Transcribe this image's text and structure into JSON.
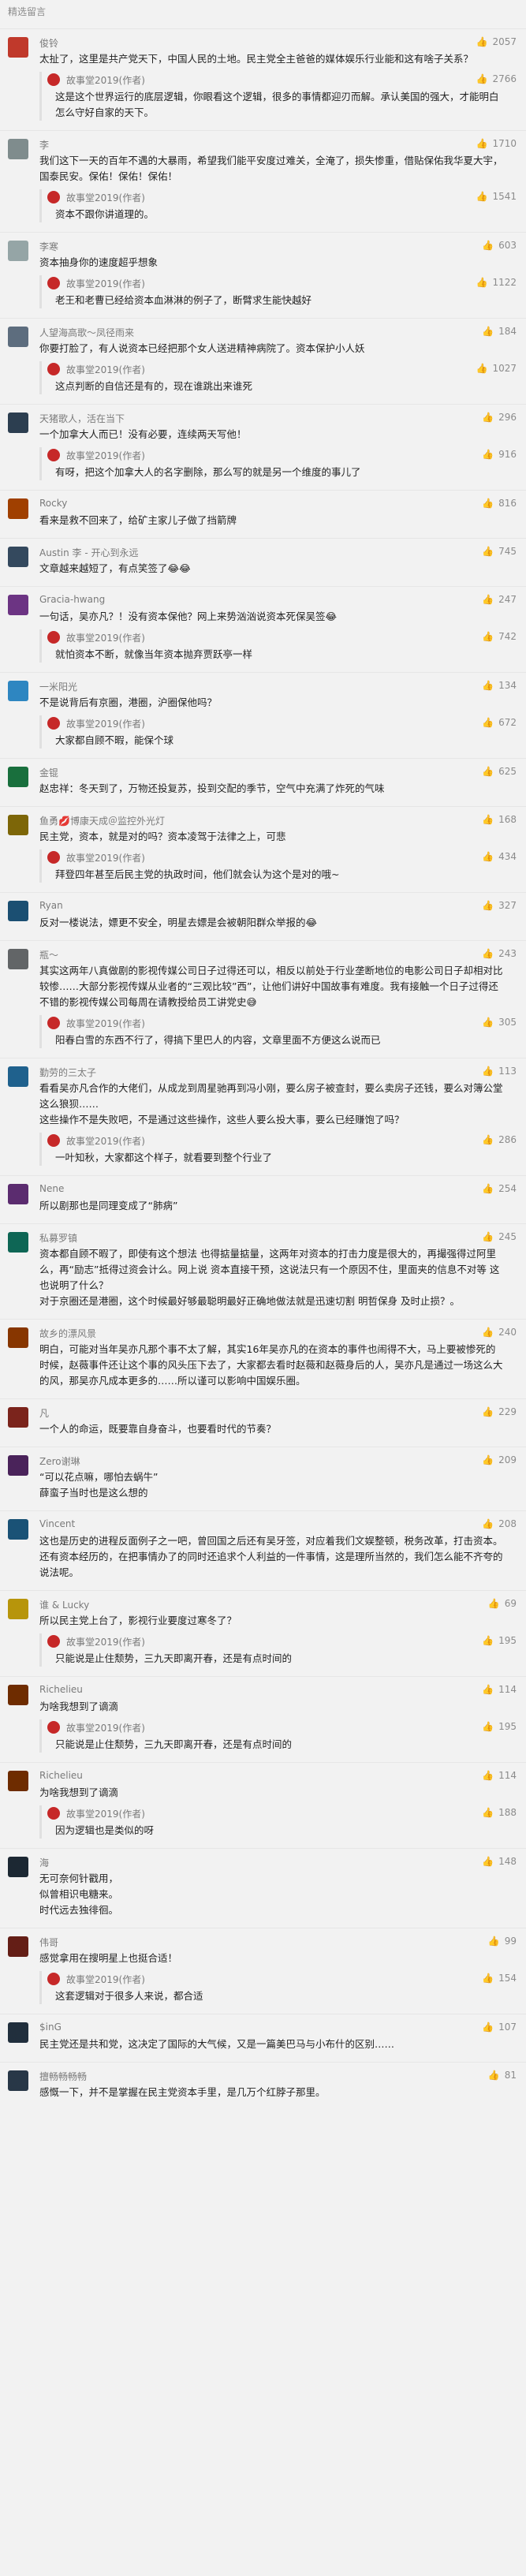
{
  "section_title": "精选留言",
  "author": "故事堂2019(作者)",
  "comments": [
    {
      "user": "俊铃",
      "likes": "2057",
      "color": "#c0392b",
      "text": "太扯了，这里是共产党天下，中国人民的土地。民主党全主爸爸的媒体娱乐行业能和这有啥子关系？",
      "reply_likes": "2766",
      "reply": "这是这个世界运行的底层逻辑，你眼看这个逻辑，很多的事情都迎刃而解。承认美国的强大，才能明白怎么守好自家的天下。"
    },
    {
      "user": "李",
      "likes": "1710",
      "color": "#7f8c8d",
      "text": "我们这下一天的百年不遇的大暴雨，希望我们能平安度过难关，全淹了，损失惨重，借贴保佑我华夏大宇，国泰民安。保佑！保佑！保佑！",
      "reply_likes": "1541",
      "reply": "资本不跟你讲道理的。"
    },
    {
      "user": "李寒",
      "likes": "603",
      "color": "#95a5a6",
      "text": "资本抽身你的速度超乎想象",
      "reply_likes": "1122",
      "reply": "老王和老曹已经给资本血淋淋的例子了，断臂求生能快越好"
    },
    {
      "user": "人望海高歌～凤径雨来",
      "likes": "184",
      "color": "#5d6d7e",
      "text": "你要打脸了，有人说资本已经把那个女人送进精神病院了。资本保护小人妖",
      "reply_likes": "1027",
      "reply": "这点判断的自信还是有的，现在谁跳出来谁死"
    },
    {
      "user": "天猪歌人，活在当下",
      "likes": "296",
      "color": "#2c3e50",
      "text": "一个加拿大人而已！没有必要，连续两天写他！",
      "reply_likes": "916",
      "reply": "有呀，把这个加拿大人的名字删除，那么写的就是另一个维度的事儿了"
    },
    {
      "user": "Rocky",
      "likes": "816",
      "color": "#a04000",
      "text": "看来是救不回来了，给矿主家儿子做了挡箭牌",
      "reply_likes": "",
      "reply": ""
    },
    {
      "user": "Austin 李 - 开心到永远",
      "likes": "745",
      "color": "#34495e",
      "text": "文章越来越短了，有点笑签了😂😂",
      "reply_likes": "",
      "reply": ""
    },
    {
      "user": "Gracia-hwang",
      "likes": "247",
      "color": "#6c3483",
      "text": "一句话，吴亦凡？！没有资本保他？网上来势汹汹说资本死保吴签😂",
      "reply_likes": "742",
      "reply": "就怕资本不断，就像当年资本抛弃贾跃亭一样"
    },
    {
      "user": "一米阳光",
      "likes": "134",
      "color": "#2e86c1",
      "text": "不是说背后有京圈，港圈，沪圈保他吗？",
      "reply_likes": "672",
      "reply": "大家都自顾不暇，能保个球"
    },
    {
      "user": "金锟",
      "likes": "625",
      "color": "#196f3d",
      "text": "赵忠祥：冬天到了，万物还投复苏，投到交配的季节，空气中充满了炸死的气味",
      "reply_likes": "",
      "reply": ""
    },
    {
      "user": "鱼勇💋博康天成＠监控外光灯",
      "likes": "168",
      "color": "#7d6608",
      "text": "民主党，资本，就是对的吗？资本凌驾于法律之上，可悲",
      "reply_likes": "434",
      "reply": "拜登四年甚至后民主党的执政时间，他们就会认为这个是对的哦~"
    },
    {
      "user": "Ryan",
      "likes": "327",
      "color": "#1b4f72",
      "text": "反对一楼说法，嫖更不安全，明星去嫖是会被朝阳群众举报的😂",
      "reply_likes": "",
      "reply": ""
    },
    {
      "user": "瓶～",
      "likes": "243",
      "color": "#626567",
      "text": "其实这两年八真做剧的影视传媒公司日子过得还可以，相反以前处于行业垄断地位的电影公司日子却相对比较惨……大部分影视传媒从业者的“三观比较”西”，让他们讲好中国故事有难度。我有接触一个日子过得还不错的影视传媒公司每周在请教授给员工讲党史😅",
      "reply_likes": "305",
      "reply": "阳春白雪的东西不行了，得搞下里巴人的内容，文章里面不方便这么说而已"
    },
    {
      "user": "勤劳的三太子",
      "likes": "113",
      "color": "#1f618d",
      "text": "看看吴亦凡合作的大佬们，从成龙到周星驰再到冯小刚，要么房子被查封，要么卖房子还钱，要么对簿公堂这么狼狈……\n这些操作不是失败吧，不是通过这些操作，这些人要么投大事，要么已经赚饱了吗？",
      "reply_likes": "286",
      "reply": "一叶知秋，大家都这个样子，就看要到整个行业了"
    },
    {
      "user": "Nene",
      "likes": "254",
      "color": "#5b2c6f",
      "text": "所以剧那也是同理变成了“肺病”",
      "reply_likes": "",
      "reply": ""
    },
    {
      "user": "私募罗镇",
      "likes": "245",
      "color": "#0e6655",
      "text": "资本都自顾不暇了，即使有这个想法 也得掂量掂量，这两年对资本的打击力度是很大的，再撮强得过阿里么，再“励志”抵得过资会计么。网上说 资本直接干预，这说法只有一个原因不住，里面夹的信息不对等 这也说明了什么？\n对于京圈还是港圈，这个时候最好够最聪明最好正确地做法就是迅速切割 明哲保身 及时止损？。",
      "reply_likes": "",
      "reply": ""
    },
    {
      "user": "故乡的漂风景",
      "likes": "240",
      "color": "#873600",
      "text": "明白，可能对当年吴亦凡那个事不太了解，其实16年吴亦凡的在资本的事件也闹得不大，马上要被惨死的时候，赵薇事件还让这个事的风头压下去了，大家都去看时赵薇和赵薇身后的人，吴亦凡是通过一场这么大的风，那吴亦凡成本更多的……所以谨可以影响中国娱乐圈。",
      "reply_likes": "",
      "reply": ""
    },
    {
      "user": "凡",
      "likes": "229",
      "color": "#7b241c",
      "text": "一个人的命运，既要靠自身奋斗，也要看时代的节奏？",
      "reply_likes": "",
      "reply": ""
    },
    {
      "user": "Zero谢琳",
      "likes": "209",
      "color": "#4a235a",
      "text": "“可以花点嘛，哪怕去蜗牛”\n薛蛮子当时也是这么想的",
      "reply_likes": "",
      "reply": ""
    },
    {
      "user": "Vincent",
      "likes": "208",
      "color": "#1a5276",
      "text": "这也是历史的进程反面例子之一吧，曾回国之后还有吴牙签，对应着我们文娱整顿，税务改革，打击资本。还有资本经历的，在把事情办了的同时还追求个人利益的一件事情，这是理所当然的，我们怎么能不齐夸的说法呢。",
      "reply_likes": "",
      "reply": ""
    },
    {
      "user": "谁 & Lucky",
      "likes": "69",
      "color": "#b7950b",
      "text": "所以民主党上台了，影视行业要度过寒冬了？",
      "reply_likes": "195",
      "reply": "只能说是止住颓势，三九天即离开春，还是有点时间的"
    },
    {
      "user": "Richelieu",
      "likes": "114",
      "color": "#6e2c00",
      "text": "为啥我想到了谪滴",
      "reply_likes": "195",
      "reply": "只能说是止住颓势，三九天即离开春，还是有点时间的"
    },
    {
      "user": "Richelieu",
      "likes": "114",
      "color": "#6e2c00",
      "text": "为啥我想到了谪滴",
      "reply_likes": "188",
      "reply": "因为逻辑也是类似的呀"
    },
    {
      "user": "海",
      "likes": "148",
      "color": "#1c2833",
      "text": "无可奈何针戳用，\n似曾相识电糖来。\n时代远去独徘徊。",
      "reply_likes": "",
      "reply": ""
    },
    {
      "user": "伟哥",
      "likes": "99",
      "color": "#641e16",
      "text": "感觉拿用在搜明星上也挺合适！",
      "reply_likes": "154",
      "reply": "这套逻辑对于很多人来说，都合适"
    },
    {
      "user": "$inG",
      "likes": "107",
      "color": "#212f3d",
      "text": "民主党还是共和党，这决定了国际的大气候，又是一篇美巴马与小布什的区别……",
      "reply_likes": "",
      "reply": ""
    },
    {
      "user": "擅畅畅畅畅",
      "likes": "81",
      "color": "#283747",
      "text": "感慨一下，并不是掌握在民主党资本手里，是几万个红脖子那里。",
      "reply_likes": "",
      "reply": ""
    }
  ]
}
